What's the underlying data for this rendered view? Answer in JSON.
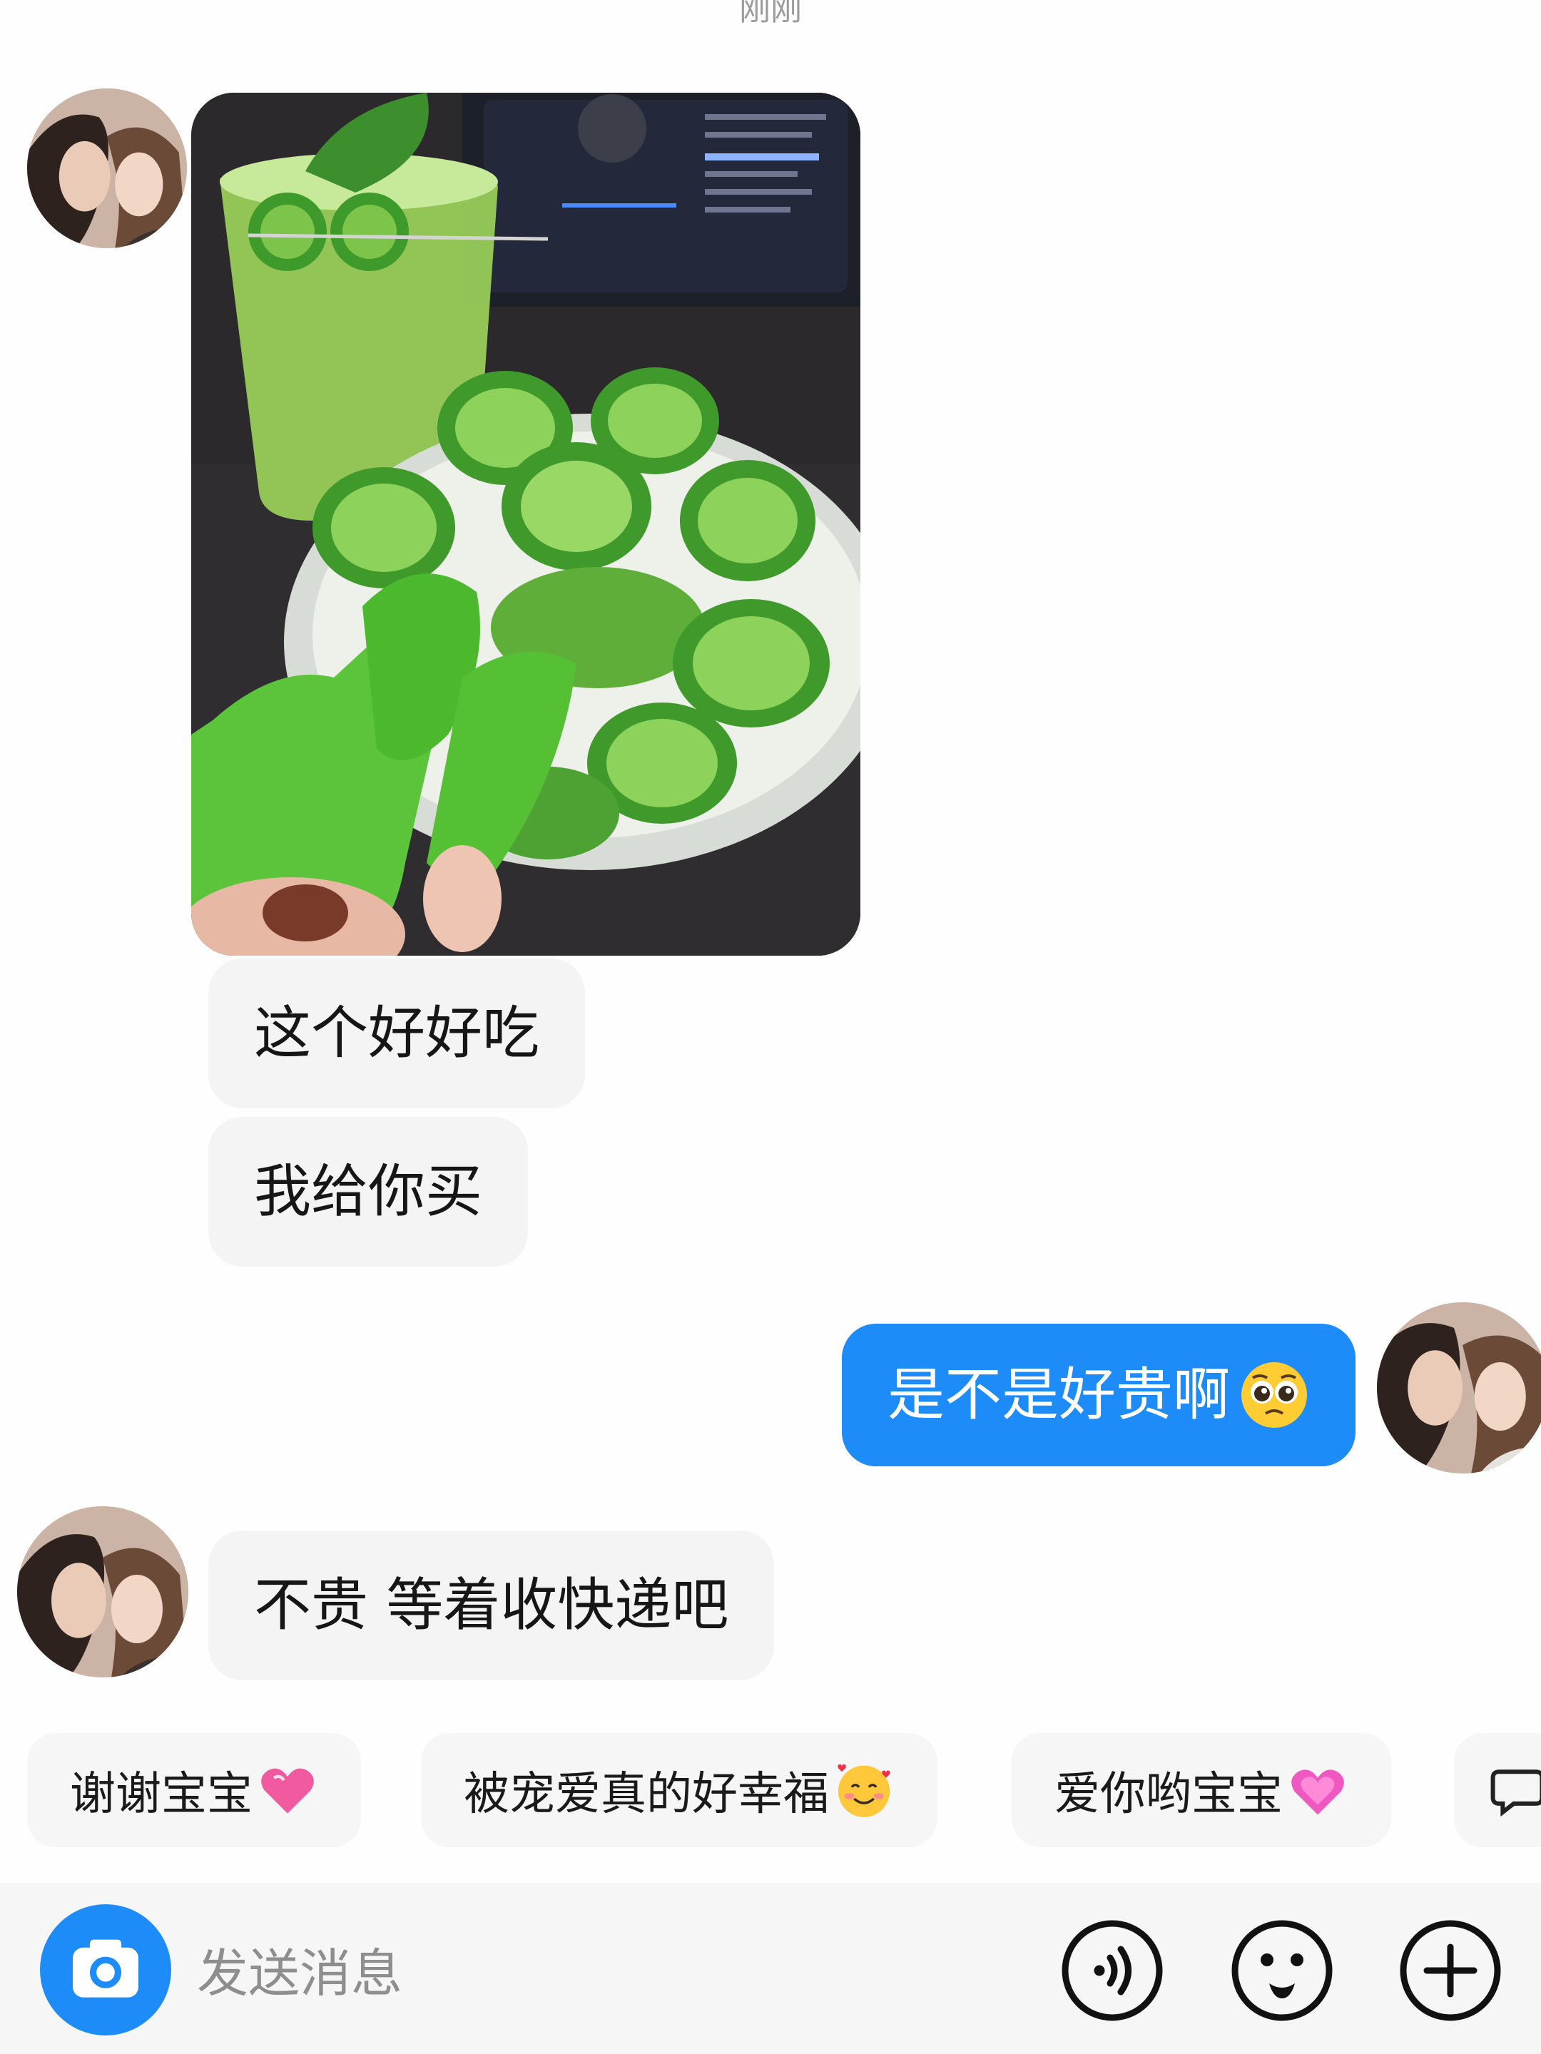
{
  "timestamp": "刚刚",
  "messages": [
    {
      "side": "left",
      "type": "image",
      "alt": "kiwi-berries-photo"
    },
    {
      "side": "left",
      "type": "text",
      "text": "这个好好吃"
    },
    {
      "side": "left",
      "type": "text",
      "text": "我给你买"
    },
    {
      "side": "right",
      "type": "text",
      "text": "是不是好贵啊",
      "emoji": "pleading-face"
    },
    {
      "side": "left",
      "type": "text",
      "text": "不贵 等着收快递吧"
    }
  ],
  "quick_replies": [
    {
      "text": "谢谢宝宝",
      "emoji": "sparkling-heart"
    },
    {
      "text": "被宠爱真的好幸福",
      "emoji": "smiling-face-with-hearts"
    },
    {
      "text": "爱你哟宝宝",
      "emoji": "growing-heart"
    },
    {
      "text": "",
      "emoji": "chat-bubble-icon"
    }
  ],
  "input": {
    "placeholder": "发送消息",
    "camera_icon": "camera-icon",
    "voice_icon": "voice-icon",
    "emoji_icon": "emoji-icon",
    "plus_icon": "plus-icon"
  },
  "colors": {
    "accent": "#1d8cf8",
    "bubble_left": "#f4f4f4",
    "bubble_right": "#1d8cf8",
    "background": "#fefefe"
  }
}
